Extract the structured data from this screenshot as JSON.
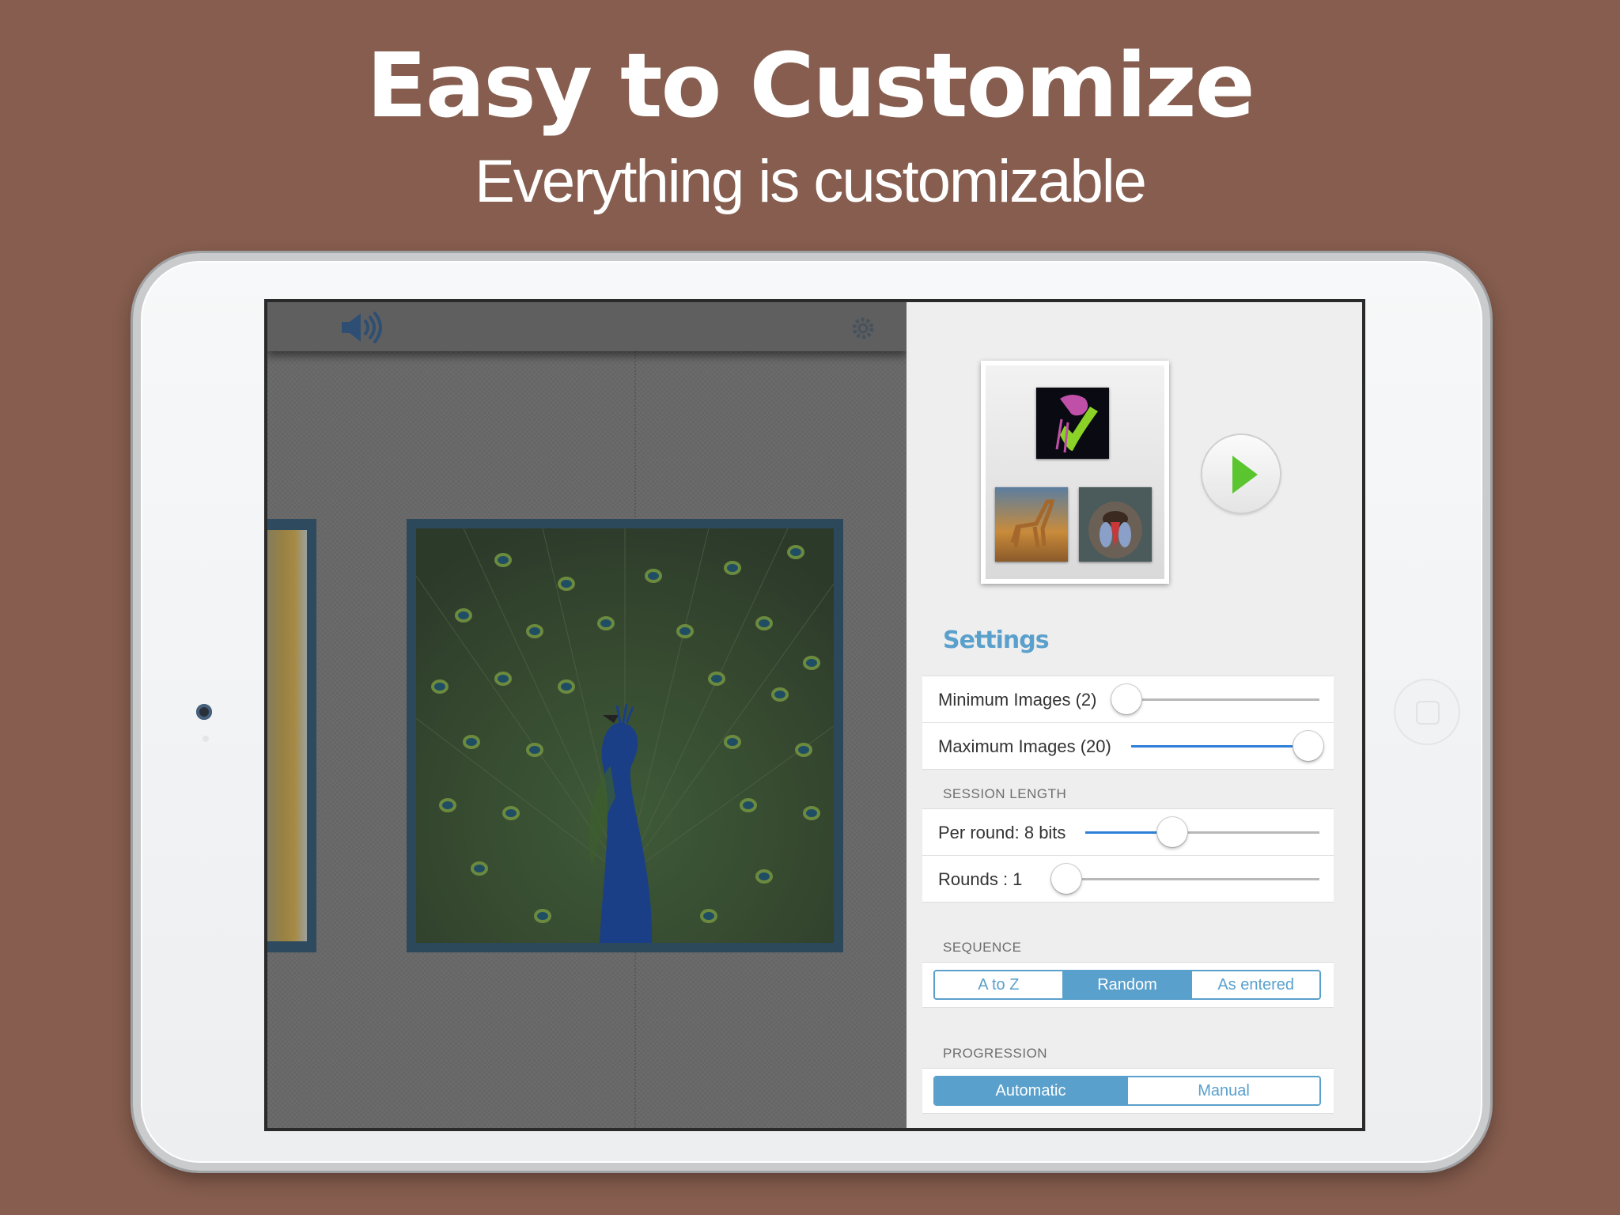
{
  "promo": {
    "headline": "Easy to Customize",
    "subheadline": "Everything is customizable"
  },
  "toolbar": {
    "speaker_icon": "speaker-icon",
    "gear_icon": "gear-icon"
  },
  "settings": {
    "title": "Settings",
    "images": [
      {
        "label": "Minimum Images (2)",
        "fraction": 0.04
      },
      {
        "label": "Maximum Images (20)",
        "fraction": 0.94
      }
    ],
    "session_length": {
      "header": "SESSION LENGTH",
      "rows": [
        {
          "label": "Per round: 8 bits",
          "fraction": 0.37
        },
        {
          "label": "Rounds : 1",
          "fraction": 0.0
        }
      ]
    },
    "sequence": {
      "header": "SEQUENCE",
      "options": [
        "A to Z",
        "Random",
        "As entered"
      ],
      "selected": "Random"
    },
    "progression": {
      "header": "PROGRESSION",
      "options": [
        "Automatic",
        "Manual"
      ],
      "selected": "Automatic"
    }
  },
  "colors": {
    "background": "#865d4e",
    "accent": "#5aa0cc",
    "slider_fill": "#2f7fd8",
    "play": "#5ac52e"
  }
}
